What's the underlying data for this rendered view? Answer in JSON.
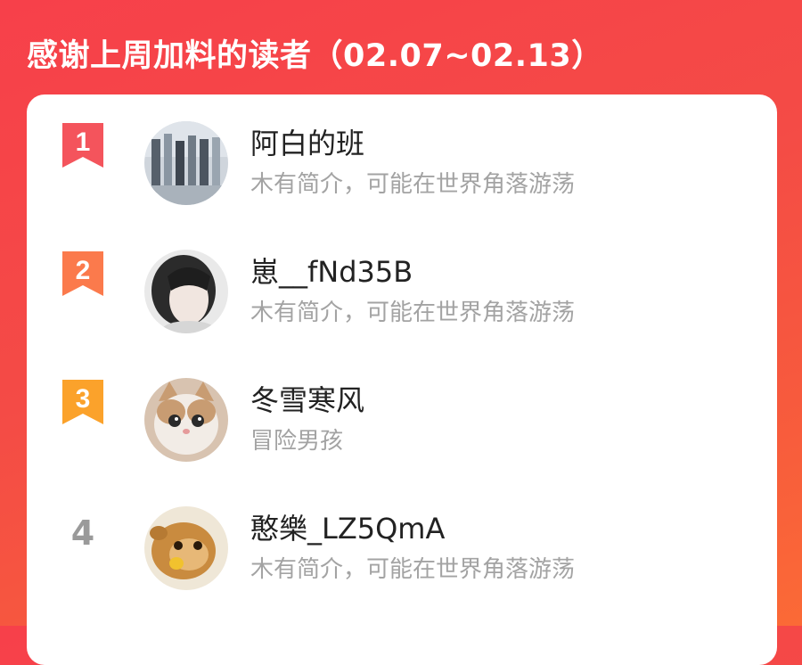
{
  "header": {
    "title": "感谢上周加料的读者（02.07~02.13）"
  },
  "readers": [
    {
      "rank": "1",
      "rank_color": "#f4545c",
      "name": "阿白的班",
      "bio": "木有简介，可能在世界角落游荡",
      "avatar_icon": "photo-group-avatar"
    },
    {
      "rank": "2",
      "rank_color": "#fb7a4c",
      "name": "崽__fNd35B",
      "bio": "木有简介，可能在世界角落游荡",
      "avatar_icon": "girl-portrait-avatar"
    },
    {
      "rank": "3",
      "rank_color": "#fba22b",
      "name": "冬雪寒风",
      "bio": "冒险男孩",
      "avatar_icon": "cat-avatar"
    },
    {
      "rank": "4",
      "rank_color": "#9a9a9a",
      "name": "憨樂_LZ5QmA",
      "bio": "木有简介，可能在世界角落游荡",
      "avatar_icon": "monkey-avatar"
    }
  ]
}
